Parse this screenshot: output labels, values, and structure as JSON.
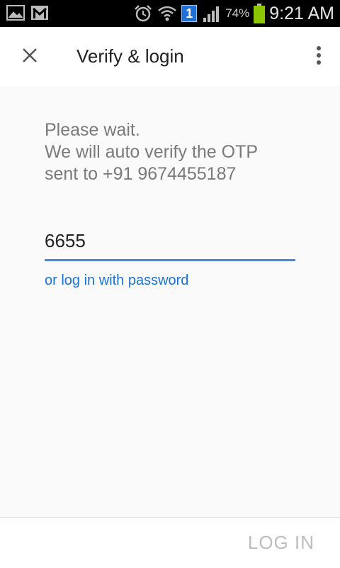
{
  "status_bar": {
    "icons_left": [
      "gallery-icon",
      "gmail-icon"
    ],
    "icons_right": [
      "alarm-icon",
      "wifi-icon",
      "notification-badge-icon",
      "signal-icon",
      "battery-icon"
    ],
    "notification_count": "1",
    "battery_percent": "74%",
    "time": "9:21 AM",
    "battery_color": "#8bc600"
  },
  "toolbar": {
    "title": "Verify & login",
    "close_icon": "close-icon",
    "more_icon": "more-vertical-icon"
  },
  "content": {
    "message_line1": "Please wait.",
    "message_line2": "We will auto verify the OTP",
    "message_line3": "sent to +91 9674455187",
    "otp_value": "6655",
    "password_link": "or log in with password",
    "accent_color": "#3f88e3"
  },
  "footer": {
    "login_label": "LOG IN"
  }
}
